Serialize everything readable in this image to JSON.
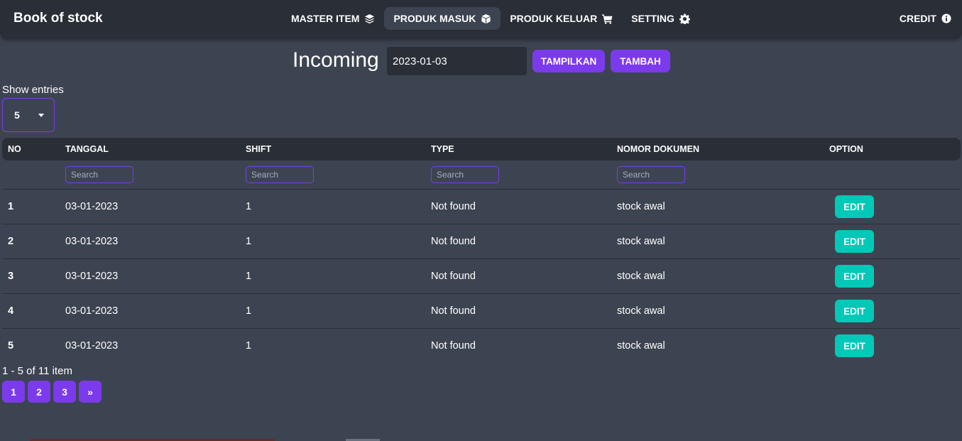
{
  "app": {
    "brand": "Book of stock"
  },
  "nav": {
    "items": [
      {
        "label": "MASTER ITEM",
        "icon": "layers-icon"
      },
      {
        "label": "PRODUK MASUK",
        "icon": "box-icon",
        "active": true
      },
      {
        "label": "PRODUK KELUAR",
        "icon": "cart-icon"
      },
      {
        "label": "SETTING",
        "icon": "gear-icon"
      }
    ],
    "credit": {
      "label": "CREDIT",
      "icon": "info-icon"
    }
  },
  "toolbar": {
    "title": "Incoming",
    "date_value": "2023-01-03",
    "show_button": "TAMPILKAN",
    "add_button": "TAMBAH"
  },
  "entries": {
    "label": "Show entries",
    "value": "5"
  },
  "table": {
    "columns": [
      "NO",
      "TANGGAL",
      "SHIFT",
      "TYPE",
      "NOMOR DOKUMEN",
      "OPTION"
    ],
    "filter_placeholder": "Search",
    "rows": [
      {
        "no": "1",
        "tanggal": "03-01-2023",
        "shift": "1",
        "type": "Not found",
        "nomor": "stock awal",
        "option": "EDIT"
      },
      {
        "no": "2",
        "tanggal": "03-01-2023",
        "shift": "1",
        "type": "Not found",
        "nomor": "stock awal",
        "option": "EDIT"
      },
      {
        "no": "3",
        "tanggal": "03-01-2023",
        "shift": "1",
        "type": "Not found",
        "nomor": "stock awal",
        "option": "EDIT"
      },
      {
        "no": "4",
        "tanggal": "03-01-2023",
        "shift": "1",
        "type": "Not found",
        "nomor": "stock awal",
        "option": "EDIT"
      },
      {
        "no": "5",
        "tanggal": "03-01-2023",
        "shift": "1",
        "type": "Not found",
        "nomor": "stock awal",
        "option": "EDIT"
      }
    ]
  },
  "pagination": {
    "info": "1 - 5 of 11 item",
    "pages": [
      "1",
      "2",
      "3"
    ],
    "next": "»"
  },
  "colors": {
    "accent": "#7c3aed",
    "edit": "#00c9b7",
    "navbar": "#2a2e37",
    "background": "#3d4451"
  }
}
